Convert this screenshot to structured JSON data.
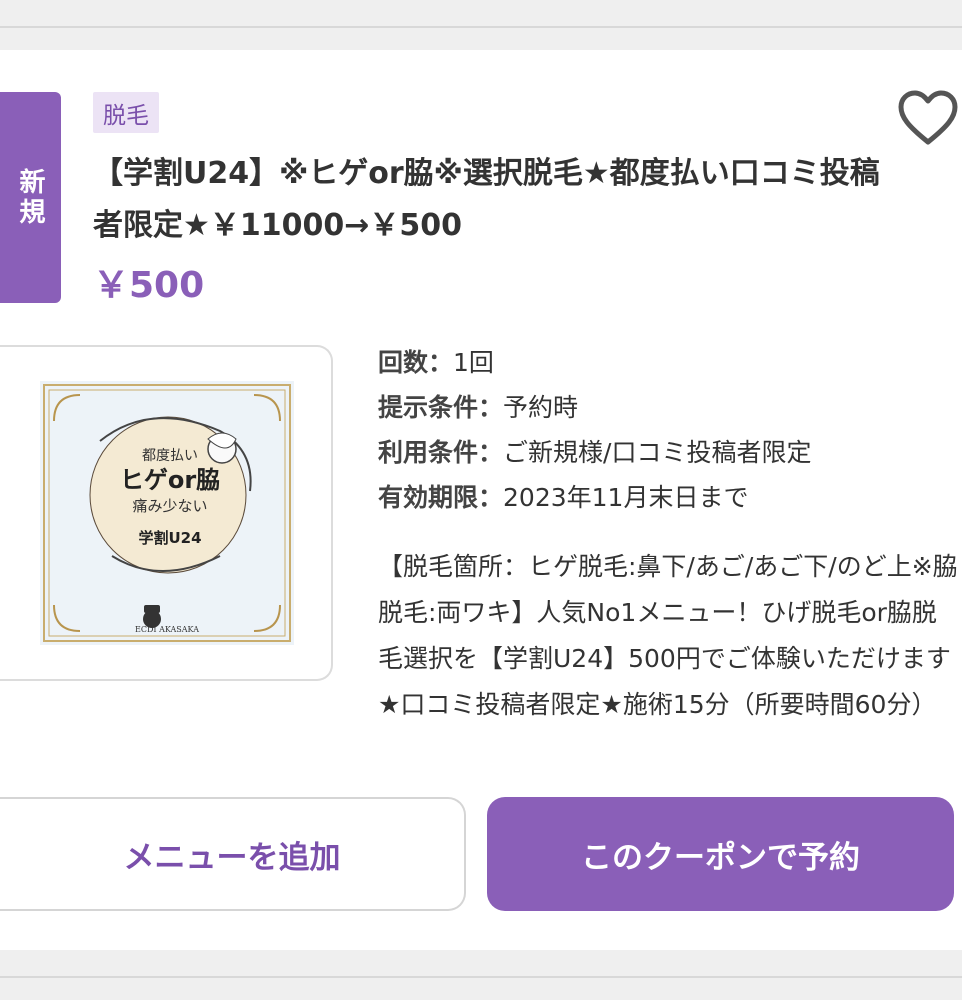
{
  "coupon": {
    "new_badge": "新規",
    "category": "脱毛",
    "title": "【学割U24】※ヒゲor脇※選択脱毛★都度払い口コミ投稿者限定★￥11000→￥500",
    "price": "￥500",
    "favorite_icon": "heart-outline-icon",
    "image": {
      "line1": "都度払い",
      "line2": "ヒゲor脇",
      "line3": "痛み少ない",
      "line4": "学割U24",
      "brand": "ECDI AKASAKA"
    },
    "details": [
      {
        "label": "回数：",
        "value": "1回"
      },
      {
        "label": "提示条件：",
        "value": "予約時"
      },
      {
        "label": "利用条件：",
        "value": "ご新規様/口コミ投稿者限定"
      },
      {
        "label": "有効期限：",
        "value": "2023年11月末日まで"
      }
    ],
    "description": "【脱毛箇所：ヒゲ脱毛:鼻下/あご/あご下/のど上※脇脱毛:両ワキ】人気No1メニュー！ひげ脱毛or脇脱毛選択を【学割U24】500円でご体験いただけます★口コミ投稿者限定★施術15分（所要時間60分）"
  },
  "buttons": {
    "add_menu": "メニューを追加",
    "reserve": "このクーポンで予約"
  },
  "colors": {
    "accent": "#8a5fb8",
    "tag_bg": "#ece3f5"
  }
}
